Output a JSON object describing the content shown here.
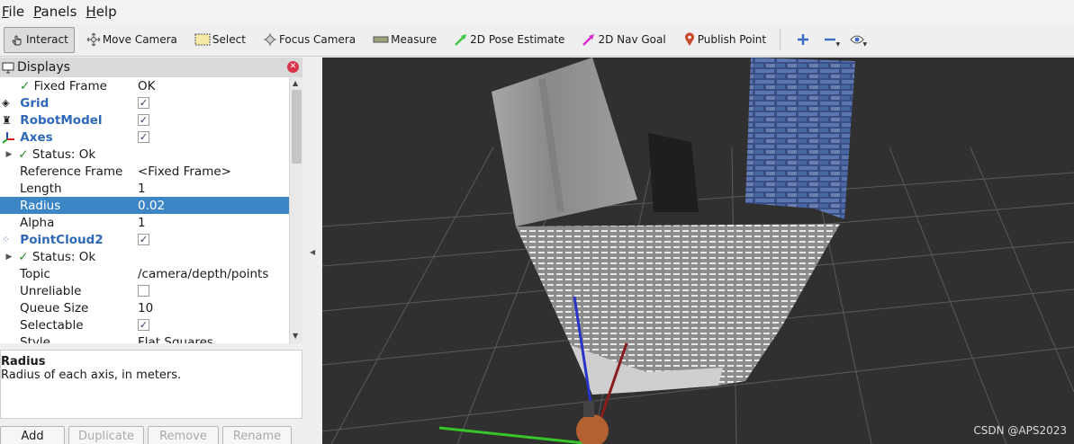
{
  "menu": {
    "items": [
      "File",
      "Panels",
      "Help"
    ]
  },
  "toolbar": {
    "tools": [
      "Interact",
      "Move Camera",
      "Select",
      "Focus Camera",
      "Measure",
      "2D Pose Estimate",
      "2D Nav Goal",
      "Publish Point"
    ],
    "extra_icons": [
      "plus-icon",
      "minus-icon",
      "eye-icon"
    ]
  },
  "displays": {
    "title": "Displays",
    "rows": [
      {
        "name": "Fixed Frame",
        "value": "OK"
      },
      {
        "name": "Grid"
      },
      {
        "name": "RobotModel"
      },
      {
        "name": "Axes"
      },
      {
        "name": "Status: Ok"
      },
      {
        "name": "Reference Frame",
        "value": "<Fixed Frame>"
      },
      {
        "name": "Length",
        "value": "1"
      },
      {
        "name": "Radius",
        "value": "0.02"
      },
      {
        "name": "Alpha",
        "value": "1"
      },
      {
        "name": "PointCloud2"
      },
      {
        "name": "Status: Ok"
      },
      {
        "name": "Topic",
        "value": "/camera/depth/points"
      },
      {
        "name": "Unreliable"
      },
      {
        "name": "Queue Size",
        "value": "10"
      },
      {
        "name": "Selectable"
      },
      {
        "name": "Style",
        "value": "Flat Squares"
      }
    ],
    "description": {
      "title": "Radius",
      "text": "Radius of each axis, in meters."
    },
    "buttons": [
      "Add",
      "Duplicate",
      "Remove",
      "Rename"
    ]
  },
  "viewport": {
    "watermark": "CSDN @APS2023"
  },
  "colors": {
    "selection": "#3d86c6",
    "link": "#2e68b9",
    "viewport_bg": "#303030",
    "check_green": "#2e8b2e"
  }
}
